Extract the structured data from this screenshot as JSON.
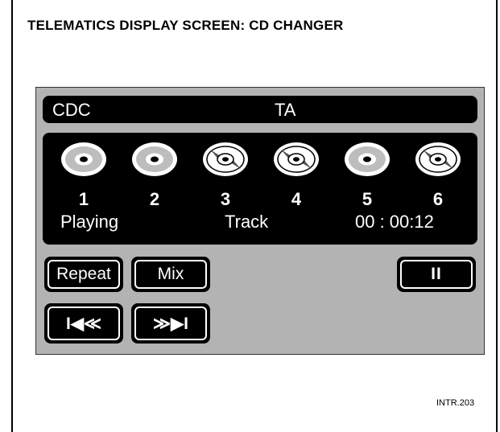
{
  "heading": "TELEMATICS DISPLAY SCREEN: CD CHANGER",
  "figure_ref": "INTR.203",
  "display": {
    "mode": "CDC",
    "ta": "TA",
    "discs": [
      {
        "number": "1",
        "style": "filled"
      },
      {
        "number": "2",
        "style": "filled"
      },
      {
        "number": "3",
        "style": "striped"
      },
      {
        "number": "4",
        "style": "striped"
      },
      {
        "number": "5",
        "style": "filled"
      },
      {
        "number": "6",
        "style": "striped"
      }
    ],
    "status": "Playing",
    "track_label": "Track",
    "time": "00 : 00:12"
  },
  "buttons": {
    "repeat": "Repeat",
    "mix": "Mix",
    "pause": "II",
    "previous": "I◀≪",
    "next": "≫▶I"
  }
}
